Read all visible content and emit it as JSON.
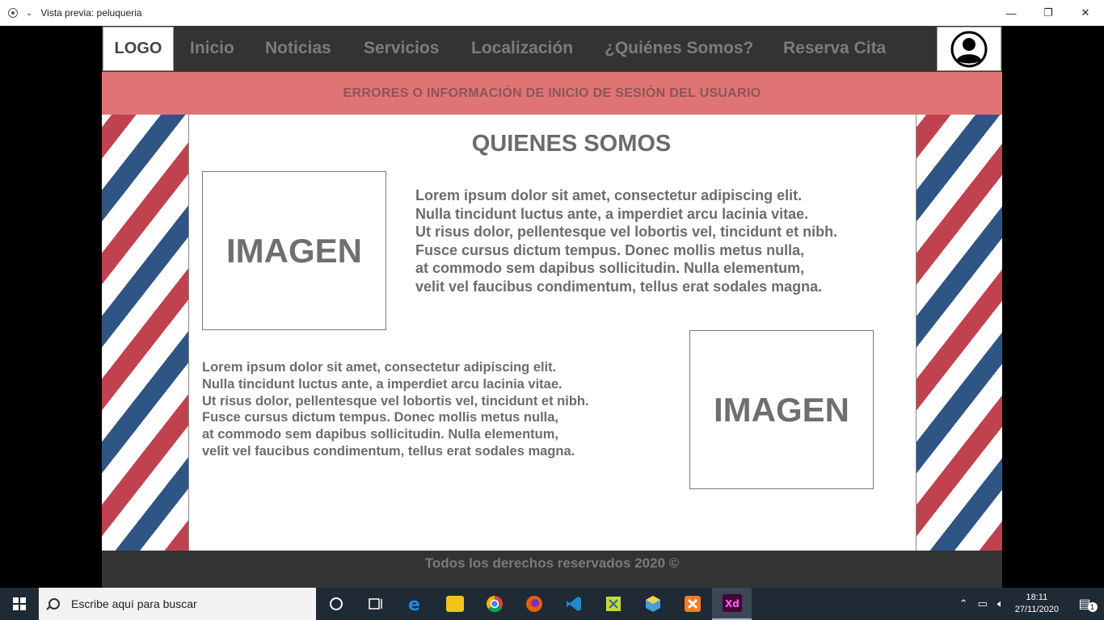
{
  "window": {
    "title": "Vista previa: peluqueria",
    "minimize": "—",
    "restore": "❐",
    "close": "✕"
  },
  "nav": {
    "logo": "LOGO",
    "items": [
      "Inicio",
      "Noticias",
      "Servicios",
      "Localización",
      "¿Quiénes Somos?",
      "Reserva Cita"
    ],
    "user_icon": "user-avatar-icon"
  },
  "banner": "ERRORES O INFORMACIÓN DE INICIO DE SESIÓN DEL USUARIO",
  "main": {
    "title": "QUIENES SOMOS",
    "image_label": "IMAGEN",
    "paragraph1": "Lorem ipsum dolor sit amet, consectetur adipiscing elit.\nNulla tincidunt luctus ante, a imperdiet arcu lacinia vitae.\nUt risus dolor, pellentesque vel lobortis vel, tincidunt et nibh.\nFusce cursus dictum tempus. Donec mollis metus nulla,\nat commodo sem dapibus sollicitudin. Nulla elementum,\nvelit vel faucibus condimentum, tellus erat sodales magna.",
    "paragraph2": "Lorem ipsum dolor sit amet, consectetur adipiscing elit.\nNulla tincidunt luctus ante, a imperdiet arcu lacinia vitae.\nUt risus dolor, pellentesque vel lobortis vel, tincidunt et nibh.\nFusce cursus dictum tempus. Donec mollis metus nulla,\nat commodo sem dapibus sollicitudin. Nulla elementum,\nvelit vel faucibus condimentum, tellus erat sodales magna."
  },
  "footer": "Todos los derechos reservados 2020 ©",
  "taskbar": {
    "search_placeholder": "Escribe aquí para buscar",
    "time": "18:11",
    "date": "27/11/2020",
    "notifications": "1",
    "apps": [
      "cortana-icon",
      "task-view-icon",
      "edge-icon",
      "file-explorer-icon",
      "chrome-icon",
      "firefox-icon",
      "vscode-icon",
      "app-icon",
      "virtualbox-icon",
      "xampp-icon",
      "adobe-xd-icon"
    ]
  },
  "colors": {
    "nav_bg": "#333333",
    "banner_bg": "#e07474",
    "stripe_red": "#c0424e",
    "stripe_blue": "#2f5585"
  }
}
